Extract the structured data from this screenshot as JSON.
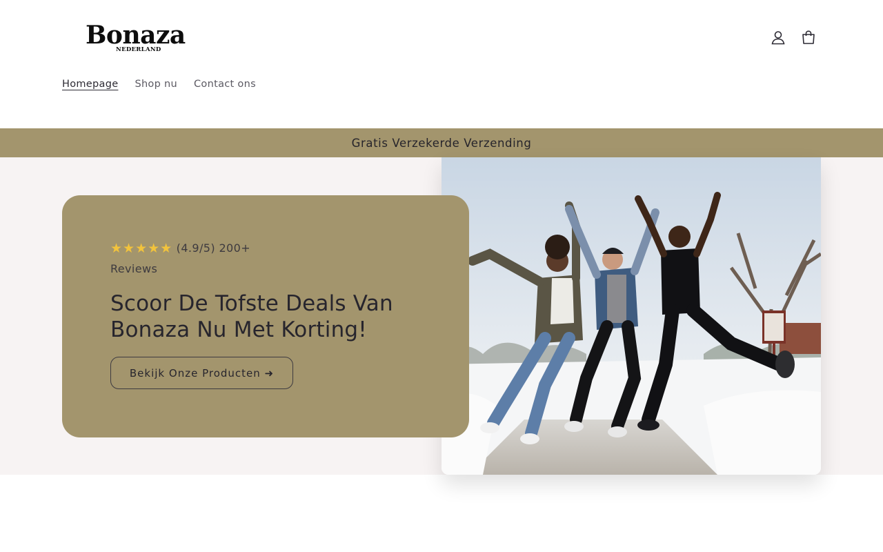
{
  "brand": {
    "name": "Bonaza",
    "tagline": "NEDERLAND"
  },
  "header": {
    "account_icon": "account-icon",
    "cart_icon": "cart-icon"
  },
  "nav": {
    "items": [
      {
        "label": "Homepage",
        "active": true
      },
      {
        "label": "Shop nu",
        "active": false
      },
      {
        "label": "Contact ons",
        "active": false
      }
    ]
  },
  "announcement": {
    "text": "Gratis Verzekerde Verzending"
  },
  "hero": {
    "rating_stars": "★★★★★",
    "rating_value": 4.9,
    "rating_text": "(4.9/5) 200+ Reviews",
    "title": "Scoor De Tofste Deals Van Bonaza Nu Met Korting!",
    "cta_label": "Bekijk Onze Producten ➜",
    "image_icon": "photo-friends-jumping-in-snow"
  },
  "colors": {
    "accent": "#a3956d",
    "hero_bg": "#f7f3f3",
    "text": "#2c2a33",
    "stars": "#f2c33c"
  }
}
